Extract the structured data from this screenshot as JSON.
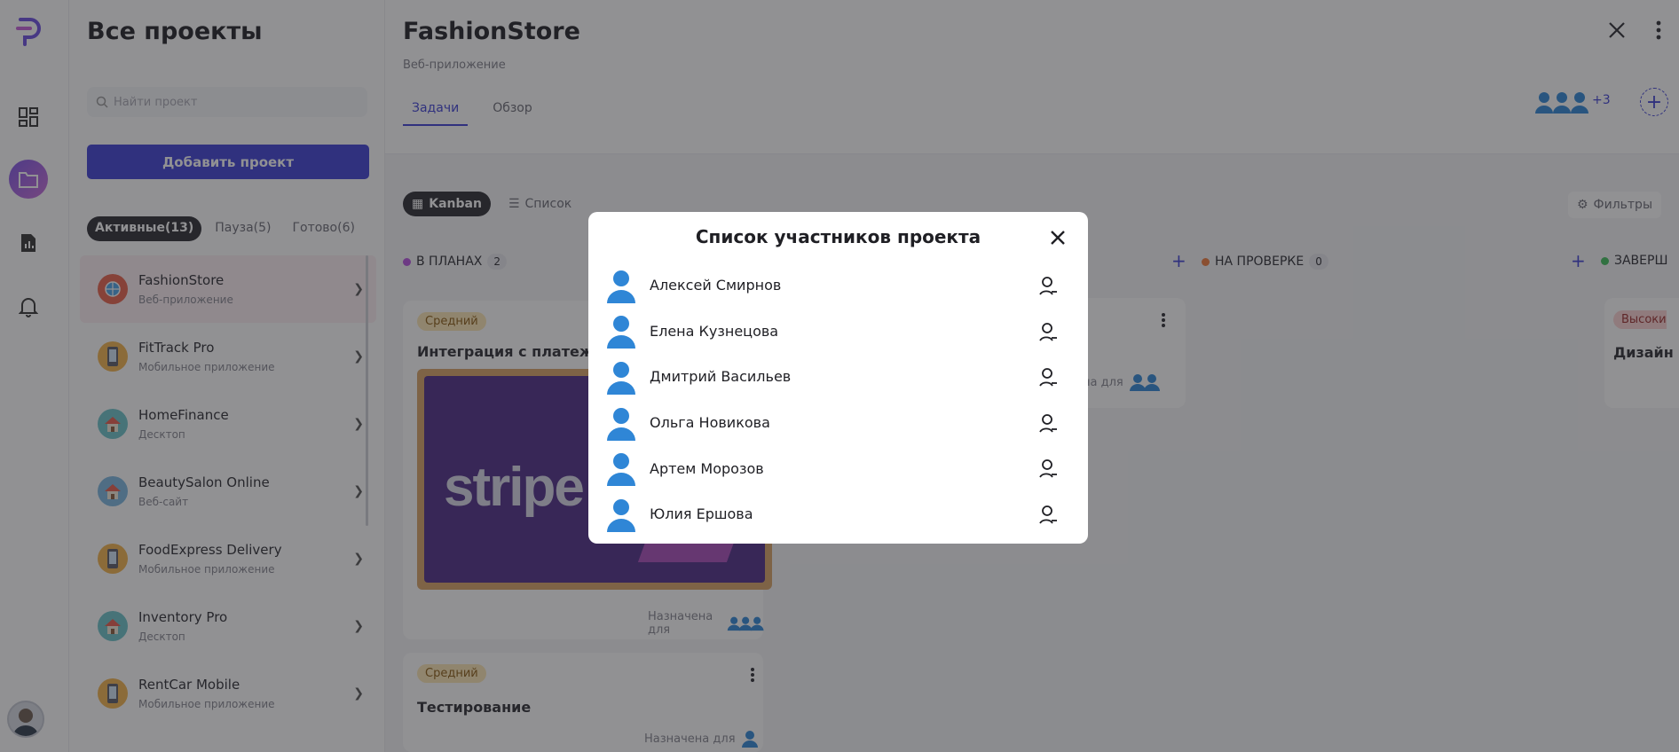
{
  "sidebar": {
    "title": "Все проекты",
    "search_placeholder": "Найти проект",
    "add_button": "Добавить проект",
    "filters": [
      {
        "label": "Активные(13)"
      },
      {
        "label": "Пауза(5)"
      },
      {
        "label": "Готово(6)"
      }
    ],
    "projects": [
      {
        "name": "FashionStore",
        "type": "Веб-приложение",
        "icon": "globe-icon"
      },
      {
        "name": "FitTrack Pro",
        "type": "Мобильное приложение",
        "icon": "phone-icon"
      },
      {
        "name": "HomeFinance",
        "type": "Десктоп",
        "icon": "house-icon"
      },
      {
        "name": "BeautySalon Online",
        "type": "Веб-сайт",
        "icon": "house-icon"
      },
      {
        "name": "FoodExpress Delivery",
        "type": "Мобильное приложение",
        "icon": "phone-icon"
      },
      {
        "name": "Inventory Pro",
        "type": "Десктоп",
        "icon": "house-icon"
      },
      {
        "name": "RentCar Mobile",
        "type": "Мобильное приложение",
        "icon": "phone-icon"
      }
    ]
  },
  "project": {
    "title": "FashionStore",
    "subtitle": "Веб-приложение",
    "tabs": [
      {
        "label": "Задачи"
      },
      {
        "label": "Обзор"
      }
    ],
    "members_extra": "+3",
    "views": [
      {
        "label": "Kanban"
      },
      {
        "label": "Список"
      }
    ],
    "filters_label": "Фильтры"
  },
  "board": {
    "columns": [
      {
        "label": "В ПЛАНАХ",
        "count": "2",
        "color": "#b651e0"
      },
      {
        "label": "НА ПРОВЕРКЕ",
        "count": "0",
        "color": "#f07a3a"
      },
      {
        "label": "ЗАВЕРШ",
        "color": "#3fbf5a"
      }
    ],
    "cards": [
      {
        "priority": "Средний",
        "title": "Интеграция с платежной",
        "image_text": "stripe",
        "assigned_label": "Назначена для"
      },
      {
        "priority": "Средний",
        "title": "Тестирование",
        "assigned_label": "Назначена для"
      },
      {
        "assigned_label": "ена для"
      },
      {
        "priority": "Высоки",
        "title": "Дизайн"
      }
    ]
  },
  "modal": {
    "title": "Список участников проекта",
    "members": [
      {
        "name": "Алексей Смирнов"
      },
      {
        "name": "Елена Кузнецова"
      },
      {
        "name": "Дмитрий Васильев"
      },
      {
        "name": "Ольга Новикова"
      },
      {
        "name": "Артем Морозов"
      },
      {
        "name": "Юлия Ершова"
      }
    ]
  },
  "colors": {
    "accent": "#3c3fd4",
    "avatar_blue": "#2f86d6",
    "overlay": "rgba(35,35,40,0.5)"
  }
}
